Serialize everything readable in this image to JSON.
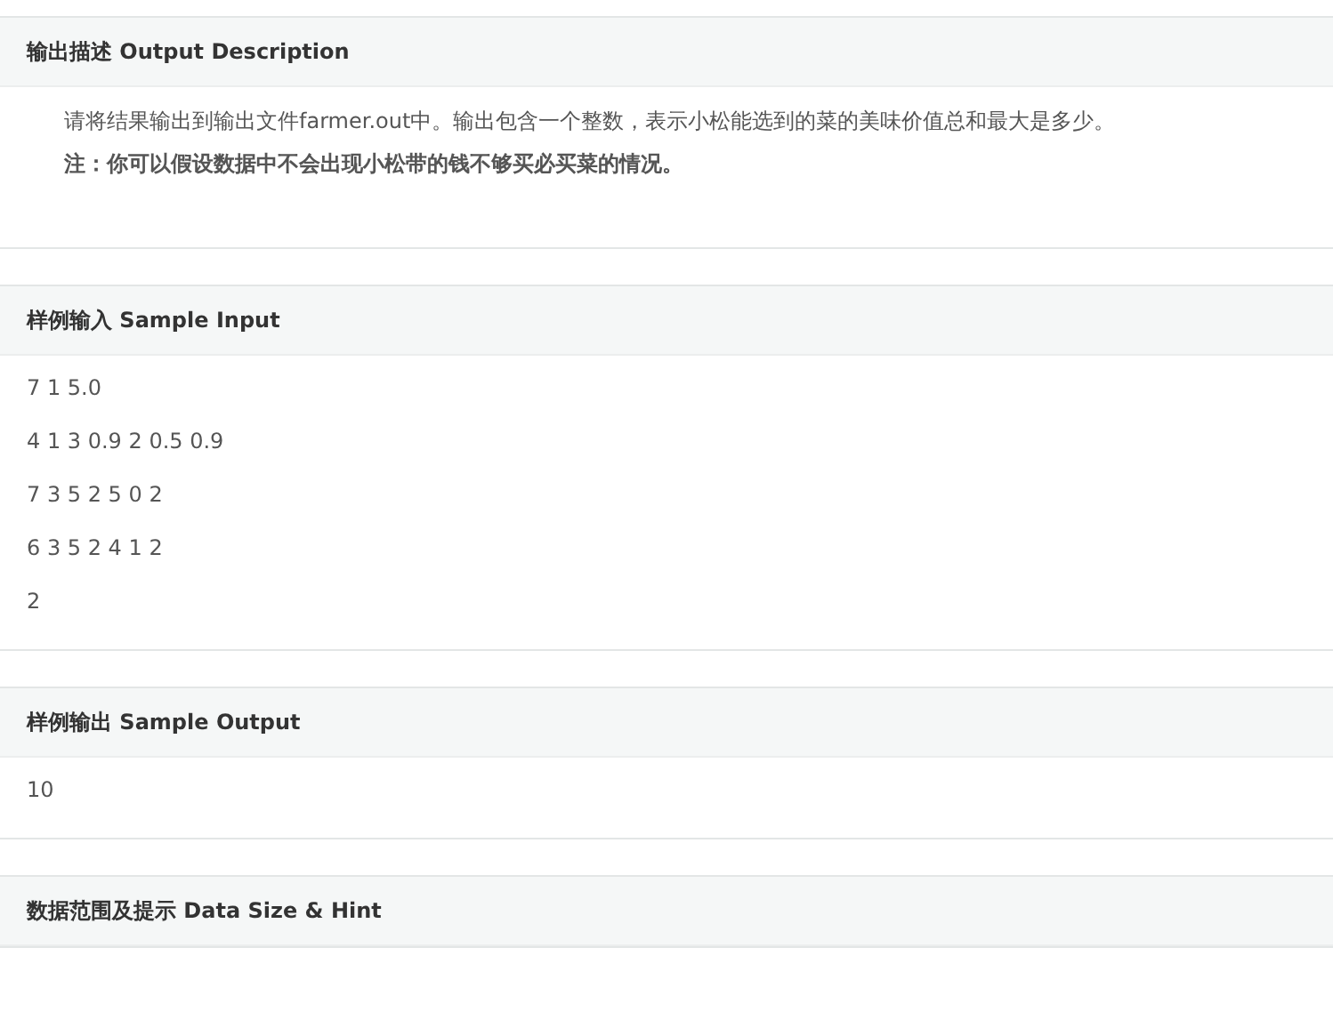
{
  "sections": [
    {
      "title": "输出描述 Output Description",
      "kind": "description",
      "paragraphs": [
        {
          "text": "请将结果输出到输出文件farmer.out中。输出包含一个整数，表示小松能选到的菜的美味价值总和最大是多少。",
          "bold": false
        },
        {
          "text": "注：你可以假设数据中不会出现小松带的钱不够买必买菜的情况。",
          "bold": true
        }
      ]
    },
    {
      "title": "样例输入 Sample Input",
      "kind": "sample",
      "lines": [
        "7 1 5.0",
        "4 1 3 0.9 2 0.5 0.9",
        "7 3 5 2 5 0 2",
        "6 3 5 2 4 1 2",
        "2"
      ]
    },
    {
      "title": "样例输出 Sample Output",
      "kind": "sample",
      "lines": [
        "10"
      ]
    },
    {
      "title": "数据范围及提示 Data Size & Hint",
      "kind": "header_only"
    }
  ]
}
